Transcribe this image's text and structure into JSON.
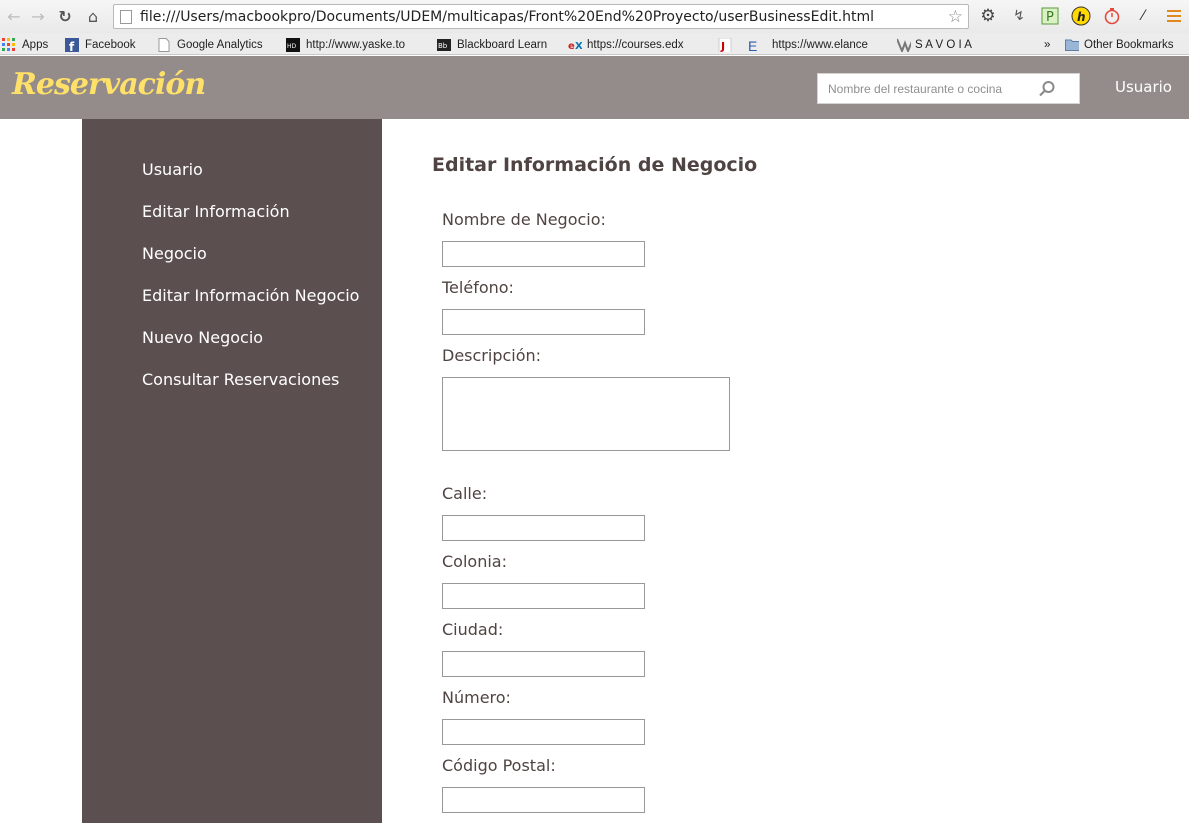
{
  "browser": {
    "url": "file:///Users/macbookpro/Documents/UDEM/multicapas/Front%20End%20Proyecto/userBusinessEdit.html",
    "bookmarks": [
      {
        "label": "Apps",
        "icon": "apps-grid-icon"
      },
      {
        "label": "Facebook",
        "icon": "facebook-icon"
      },
      {
        "label": "Google Analytics",
        "icon": "page-icon"
      },
      {
        "label": "http://www.yaske.to",
        "icon": "hd-icon"
      },
      {
        "label": "Blackboard Learn",
        "icon": "blackboard-icon"
      },
      {
        "label": "https://courses.edx",
        "icon": "edx-icon"
      },
      {
        "label": "",
        "icon": "bookmark-red-icon"
      },
      {
        "label": "https://www.elance",
        "icon": "elance-icon"
      },
      {
        "label": "S A V O I A",
        "icon": "savoia-icon"
      }
    ],
    "overflow": "»",
    "other_bookmarks": "Other Bookmarks"
  },
  "header": {
    "brand": "Reservación",
    "search_placeholder": "Nombre del restaurante o cocina",
    "user": "Usuario",
    "colors": {
      "bar": "#948c8b",
      "brand": "#ffe169"
    }
  },
  "sidebar": {
    "items": [
      {
        "label": "Usuario"
      },
      {
        "label": "Editar Información"
      },
      {
        "label": "Negocio"
      },
      {
        "label": "Editar Información Negocio"
      },
      {
        "label": "Nuevo Negocio"
      },
      {
        "label": "Consultar Reservaciones"
      }
    ],
    "color": "#5b504f"
  },
  "form": {
    "title": "Editar Información de Negocio",
    "fields": {
      "nombre": "Nombre de Negocio:",
      "telefono": "Teléfono:",
      "descripcion": "Descripción:",
      "calle": "Calle:",
      "colonia": "Colonia:",
      "ciudad": "Ciudad:",
      "numero": "Número:",
      "codigo_postal": "Código Postal:"
    }
  }
}
